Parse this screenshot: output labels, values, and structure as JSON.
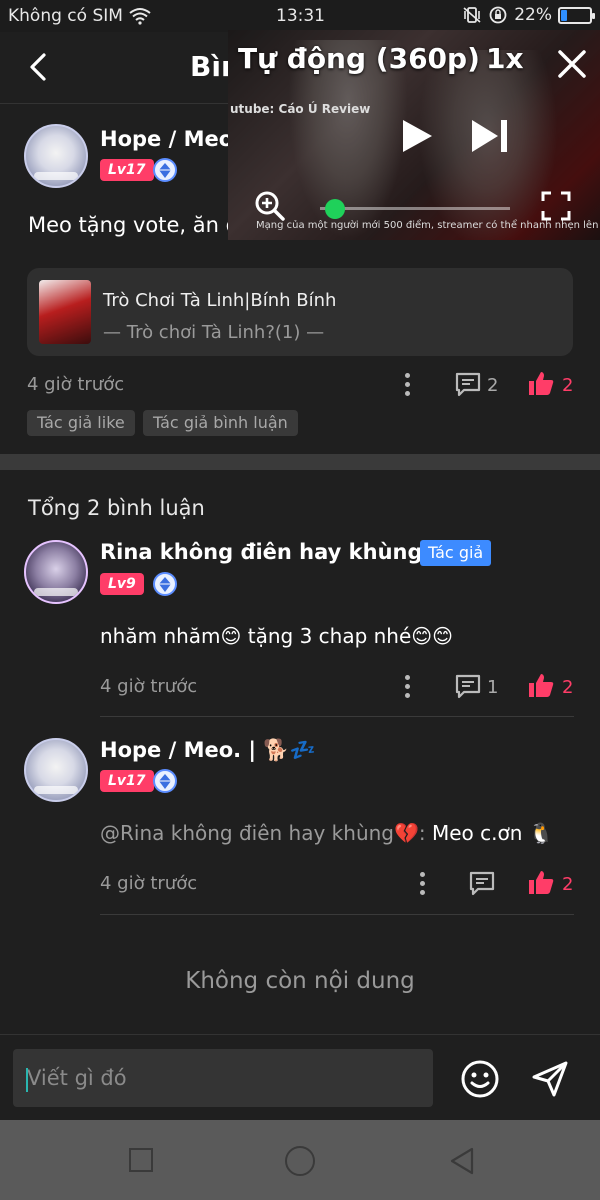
{
  "status_bar": {
    "carrier": "Không có SIM",
    "time": "13:31",
    "battery": "22%",
    "battery_level": 0.22
  },
  "header": {
    "title": "Bình luận"
  },
  "video": {
    "quality": "Tự động (360p)",
    "speed": "1x",
    "watermark": "utube: Cáo Ú Review",
    "subtitle": "Mạng của một người mới 500 điểm, streamer có thể nhanh nhẹn lên chút không?",
    "progress": 0.02
  },
  "post": {
    "username": "Hope / Meo.",
    "level": "Lv17",
    "text": "Meo tặng vote, ăn đ",
    "card": {
      "title": "Trò Chơi Tà Linh|Bính Bính",
      "subtitle": "— Trò chơi Tà Linh?(1) —"
    },
    "time": "4 giờ trước",
    "comment_count": "2",
    "like_count": "2",
    "tags": [
      "Tác giả like",
      "Tác giả bình luận"
    ]
  },
  "comments_header": "Tổng 2 bình luận",
  "comments": [
    {
      "username": "Rina không điên hay khùng💔",
      "badge": "Tác giả",
      "level": "Lv9",
      "text": "nhăm nhăm😊 tặng 3 chap nhé😊😊",
      "time": "4 giờ trước",
      "reply_count": "1",
      "like_count": "2"
    },
    {
      "username": "Hope / Meo. | 🐕💤",
      "level": "Lv17",
      "mention": "@Rina không điên hay khùng💔:",
      "text": " Meo c.ơn 🐧",
      "time": "4 giờ trước",
      "like_count": "2"
    }
  ],
  "footer_text": "Không còn nội dung",
  "input": {
    "placeholder": "Viết gì đó"
  },
  "colors": {
    "accent": "#ff3d68",
    "author_badge": "#3d8bff",
    "progress_knob": "#1fd15a"
  }
}
